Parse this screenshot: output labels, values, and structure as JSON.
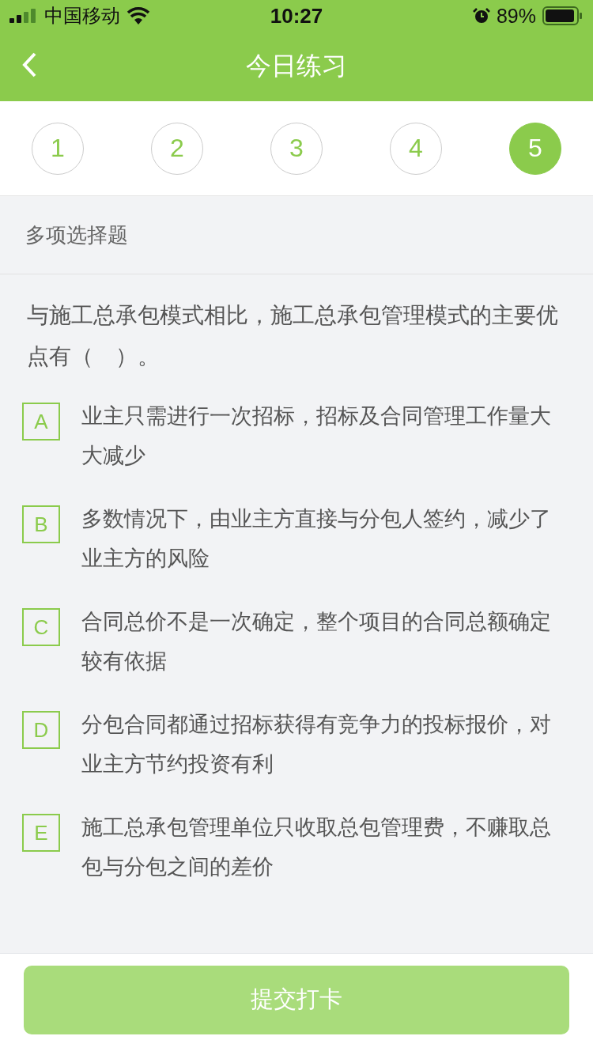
{
  "status_bar": {
    "carrier": "中国移动",
    "time": "10:27",
    "battery": "89%"
  },
  "nav": {
    "title": "今日练习"
  },
  "question_tabs": [
    {
      "label": "1",
      "selected": false
    },
    {
      "label": "2",
      "selected": false
    },
    {
      "label": "3",
      "selected": false
    },
    {
      "label": "4",
      "selected": false
    },
    {
      "label": "5",
      "selected": true
    }
  ],
  "question_type": "多项选择题",
  "question": "与施工总承包模式相比，施工总承包管理模式的主要优点有（　）。",
  "options": [
    {
      "letter": "A",
      "text": "业主只需进行一次招标，招标及合同管理工作量大大减少",
      "selected": false
    },
    {
      "letter": "B",
      "text": "多数情况下，由业主方直接与分包人签约，减少了业主方的风险",
      "selected": false
    },
    {
      "letter": "C",
      "text": "合同总价不是一次确定，整个项目的合同总额确定较有依据",
      "selected": false
    },
    {
      "letter": "D",
      "text": "分包合同都通过招标获得有竞争力的投标报价，对业主方节约投资有利",
      "selected": false
    },
    {
      "letter": "E",
      "text": "施工总承包管理单位只收取总包管理费，不赚取总包与分包之间的差价",
      "selected": false
    }
  ],
  "submit_button": {
    "label": "提交打卡",
    "disabled": true
  }
}
